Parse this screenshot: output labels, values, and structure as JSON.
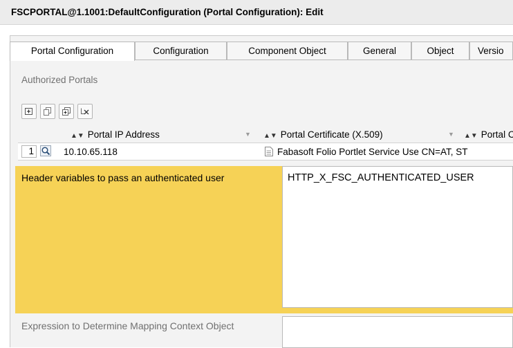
{
  "window": {
    "title": "FSCPORTAL@1.1001:DefaultConfiguration (Portal Configuration): Edit"
  },
  "tabs": [
    {
      "label": "Portal Configuration",
      "active": true
    },
    {
      "label": "Configuration",
      "active": false
    },
    {
      "label": "Component Object",
      "active": false
    },
    {
      "label": "General",
      "active": false
    },
    {
      "label": "Object",
      "active": false
    },
    {
      "label": "Versio",
      "active": false
    }
  ],
  "authorized_portals": {
    "section_label": "Authorized Portals",
    "toolbar_icons": [
      "add-row-icon",
      "copy-row-icon",
      "duplicate-row-icon",
      "delete-row-icon"
    ],
    "columns": [
      "Portal IP Address",
      "Portal Certificate (X.509)",
      "Portal C"
    ],
    "rows": [
      {
        "row_number": "1",
        "ip_address": "10.10.65.118",
        "certificate_name": "Fabasoft Folio Portlet Service Use",
        "certificate_subject": "CN=AT, ST"
      }
    ]
  },
  "header_variables": {
    "label": "Header variables to pass an authenticated user",
    "value": "HTTP_X_FSC_AUTHENTICATED_USER",
    "highlight_color": "#f6d256"
  },
  "mapping_expression": {
    "label": "Expression to Determine Mapping Context Object",
    "value": ""
  }
}
